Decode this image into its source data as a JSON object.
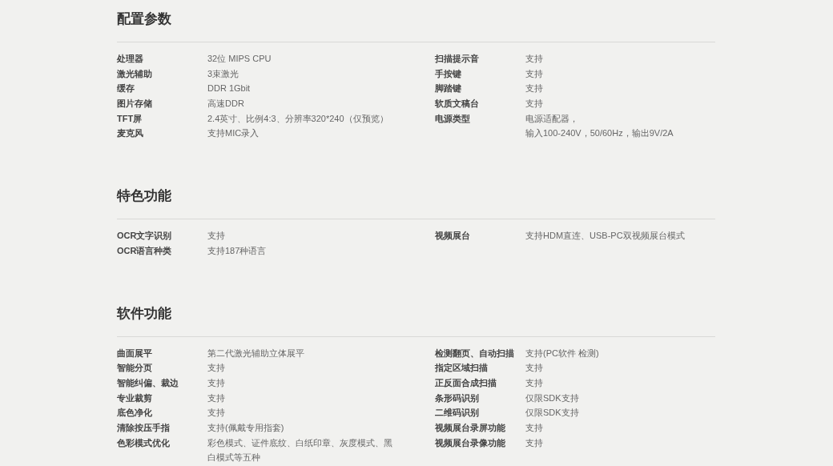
{
  "sections": [
    {
      "title": "配置参数",
      "columns": [
        [
          {
            "label": "处理器",
            "value_lines": [
              "32位 MIPS CPU"
            ]
          },
          {
            "label": "激光辅助",
            "value_lines": [
              "3束激光"
            ]
          },
          {
            "label": "缓存",
            "value_lines": [
              "DDR 1Gbit"
            ]
          },
          {
            "label": "图片存储",
            "value_lines": [
              "高速DDR"
            ]
          },
          {
            "label": "TFT屏",
            "value_lines": [
              "2.4英寸、比例4:3、分辨率320*240（仅预览）"
            ]
          },
          {
            "label": "麦克风",
            "value_lines": [
              "支持MIC录入"
            ]
          }
        ],
        [
          {
            "label": "扫描提示音",
            "value_lines": [
              "支持"
            ]
          },
          {
            "label": "手按键",
            "value_lines": [
              "支持"
            ]
          },
          {
            "label": "脚踏键",
            "value_lines": [
              "支持"
            ]
          },
          {
            "label": "软质文稿台",
            "value_lines": [
              "支持"
            ]
          },
          {
            "label": "电源类型",
            "value_lines": [
              "电源适配器，",
              "输入100-240V，50/60Hz，输出9V/2A"
            ]
          }
        ]
      ]
    },
    {
      "title": "特色功能",
      "columns": [
        [
          {
            "label": "OCR文字识别",
            "value_lines": [
              "支持"
            ]
          },
          {
            "label": "OCR语言种类",
            "value_lines": [
              "支持187种语言"
            ]
          }
        ],
        [
          {
            "label": "视频展台",
            "value_lines": [
              "支持HDM直连、USB-PC双视频展台模式"
            ]
          }
        ]
      ]
    },
    {
      "title": "软件功能",
      "columns": [
        [
          {
            "label": "曲面展平",
            "value_lines": [
              "第二代激光辅助立体展平"
            ]
          },
          {
            "label": "智能分页",
            "value_lines": [
              "支持"
            ]
          },
          {
            "label": "智能纠偏、裁边",
            "value_lines": [
              "支持"
            ]
          },
          {
            "label": "专业裁剪",
            "value_lines": [
              "支持"
            ]
          },
          {
            "label": "底色净化",
            "value_lines": [
              "支持"
            ]
          },
          {
            "label": "清除按压手指",
            "value_lines": [
              "支持(佩戴专用指套)"
            ]
          },
          {
            "label": "色彩模式优化",
            "value_lines": [
              "彩色模式、证件底纹、白纸印章、灰度模式、黑",
              "白模式等五种"
            ]
          }
        ],
        [
          {
            "label": "检测翻页、自动扫描",
            "value_lines": [
              "支持(PC软件 检测)"
            ]
          },
          {
            "label": "指定区域扫描",
            "value_lines": [
              "支持"
            ]
          },
          {
            "label": "正反面合成扫描",
            "value_lines": [
              "支持"
            ]
          },
          {
            "label": "条形码识别",
            "value_lines": [
              "仅限SDK支持"
            ]
          },
          {
            "label": "二维码识别",
            "value_lines": [
              "仅限SDK支持"
            ]
          },
          {
            "label": "视频展台录屏功能",
            "value_lines": [
              "支持"
            ]
          },
          {
            "label": "视频展台录像功能",
            "value_lines": [
              "支持"
            ]
          }
        ]
      ]
    }
  ]
}
